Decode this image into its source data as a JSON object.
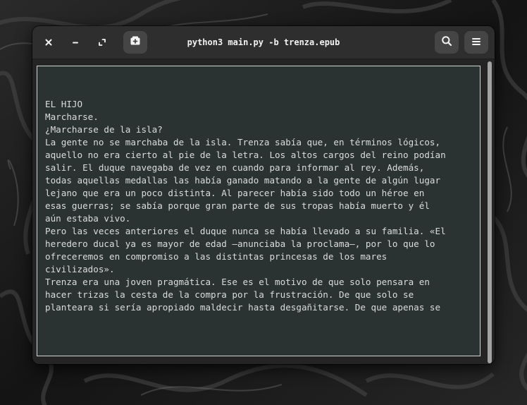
{
  "window": {
    "title": "python3 main.py -b trenza.epub"
  },
  "headerbar": {
    "close_icon": "close-icon",
    "minimize_icon": "minimize-icon",
    "maximize_icon": "maximize-icon",
    "new_tab_icon": "new-tab-icon",
    "search_icon": "search-icon",
    "menu_icon": "hamburger-menu-icon"
  },
  "terminal": {
    "lines": [
      "EL HIJO",
      "Marcharse.",
      "¿Marcharse de la isla?",
      "La gente no se marchaba de la isla. Trenza sabía que, en términos lógicos,",
      "aquello no era cierto al pie de la letra. Los altos cargos del reino podían",
      "salir. El duque navegaba de vez en cuando para informar al rey. Además,",
      "todas aquellas medallas las había ganado matando a la gente de algún lugar",
      "lejano que era un poco distinta. Al parecer había sido todo un héroe en",
      "esas guerras; se sabía porque gran parte de sus tropas había muerto y él",
      "aún estaba vivo.",
      "Pero las veces anteriores el duque nunca se había llevado a su familia. «El",
      "heredero ducal ya es mayor de edad —anunciaba la proclama—, por lo que lo",
      "ofreceremos en compromiso a las distintas princesas de los mares",
      "civilizados».",
      "Trenza era una joven pragmática. Ese es el motivo de que solo pensara en",
      "hacer trizas la cesta de la compra por la frustración. De que solo se",
      "planteara si sería apropiado maldecir hasta desgañitarse. De que apenas se"
    ]
  },
  "colors": {
    "headerbar": "#2e2e2e",
    "window": "#242424",
    "terminal_bg": "#2b3232",
    "terminal_border": "#cfd6d4",
    "text": "#dcdcdc",
    "scroll_thumb": "#a2a2a2"
  }
}
